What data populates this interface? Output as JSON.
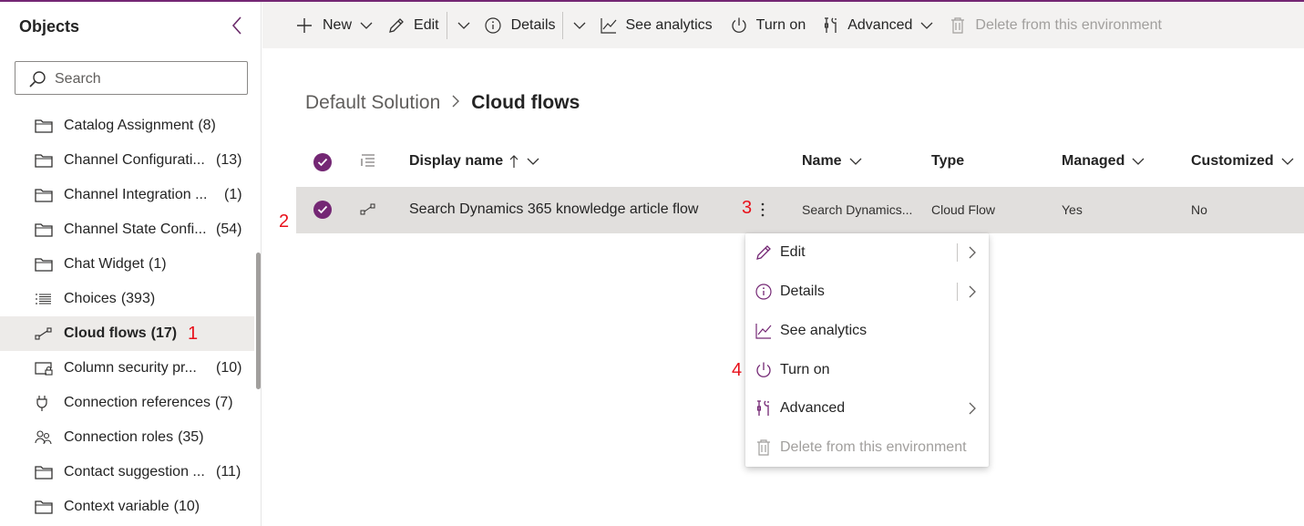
{
  "sidebar": {
    "title": "Objects",
    "search_placeholder": "Search",
    "items": [
      {
        "label": "Catalog Assignment",
        "count": "(8)"
      },
      {
        "label": "Channel Configurati...",
        "count": "(13)"
      },
      {
        "label": "Channel Integration ...",
        "count": "(1)"
      },
      {
        "label": "Channel State Confi...",
        "count": "(54)"
      },
      {
        "label": "Chat Widget",
        "count": "(1)"
      },
      {
        "label": "Choices",
        "count": "(393)"
      },
      {
        "label": "Cloud flows",
        "count": "(17)"
      },
      {
        "label": "Column security pr...",
        "count": "(10)"
      },
      {
        "label": "Connection references",
        "count": "(7)"
      },
      {
        "label": "Connection roles",
        "count": "(35)"
      },
      {
        "label": "Contact suggestion ...",
        "count": "(11)"
      },
      {
        "label": "Context variable",
        "count": "(10)"
      }
    ]
  },
  "toolbar": {
    "new": "New",
    "edit": "Edit",
    "details": "Details",
    "see_analytics": "See analytics",
    "turn_on": "Turn on",
    "advanced": "Advanced",
    "delete": "Delete from this environment"
  },
  "breadcrumb": {
    "parent": "Default Solution",
    "current": "Cloud flows"
  },
  "grid": {
    "columns": {
      "display_name": "Display name",
      "name": "Name",
      "type": "Type",
      "managed": "Managed",
      "customized": "Customized"
    },
    "rows": [
      {
        "display_name": "Search Dynamics 365 knowledge article flow",
        "name": "Search Dynamics...",
        "type": "Cloud Flow",
        "managed": "Yes",
        "customized": "No"
      }
    ]
  },
  "context_menu": {
    "edit": "Edit",
    "details": "Details",
    "see_analytics": "See analytics",
    "turn_on": "Turn on",
    "advanced": "Advanced",
    "delete": "Delete from this environment"
  },
  "annotations": {
    "a1": "1",
    "a2": "2",
    "a3": "3",
    "a4": "4"
  },
  "colors": {
    "accent": "#742774",
    "annotation": "#e8111b",
    "selected_row": "#e1dfdd",
    "command_bar": "#f3f2f1"
  }
}
